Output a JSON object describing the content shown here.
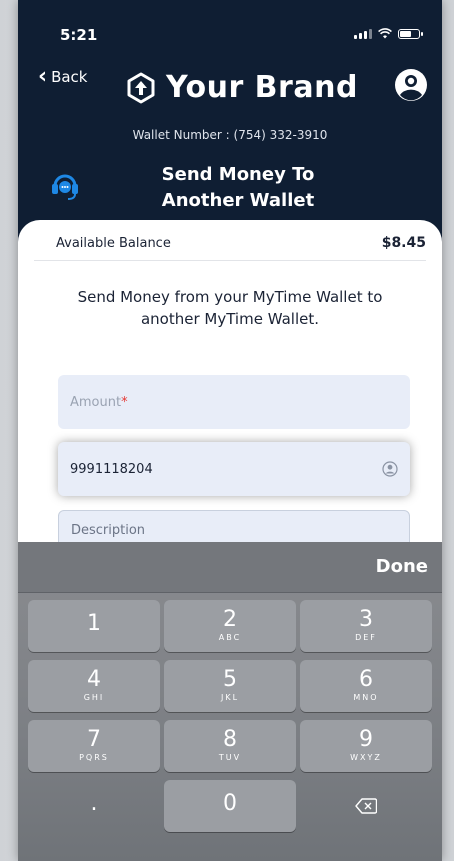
{
  "status": {
    "time": "5:21"
  },
  "header": {
    "back_label": "Back",
    "brand_name": "Your Brand",
    "wallet_number": "Wallet Number : (754) 332-3910",
    "title_line1": "Send Money To",
    "title_line2": "Another Wallet"
  },
  "card": {
    "balance_label": "Available Balance",
    "balance_value": "$8.45",
    "intro": "Send Money from your MyTime Wallet to another MyTime Wallet."
  },
  "form": {
    "amount_placeholder": "Amount",
    "amount_required_mark": "*",
    "phone_value": "9991118204",
    "description_placeholder": "Description"
  },
  "keyboard": {
    "done_label": "Done",
    "keys": [
      {
        "num": "1",
        "letters": ""
      },
      {
        "num": "2",
        "letters": "ABC"
      },
      {
        "num": "3",
        "letters": "DEF"
      },
      {
        "num": "4",
        "letters": "GHI"
      },
      {
        "num": "5",
        "letters": "JKL"
      },
      {
        "num": "6",
        "letters": "MNO"
      },
      {
        "num": "7",
        "letters": "PQRS"
      },
      {
        "num": "8",
        "letters": "TUV"
      },
      {
        "num": "9",
        "letters": "WXYZ"
      },
      {
        "num": ".",
        "letters": ""
      },
      {
        "num": "0",
        "letters": ""
      }
    ]
  },
  "colors": {
    "header_bg": "#0f1e33",
    "support_icon": "#1e88e5",
    "field_bg": "#e8edf8",
    "required": "#e53935"
  },
  "icons": {
    "back": "chevron-left-icon",
    "brand": "hexagon-arrow-up-icon",
    "profile": "user-circle-icon",
    "support": "headset-icon",
    "contact": "person-circle-icon",
    "delete": "backspace-icon"
  }
}
